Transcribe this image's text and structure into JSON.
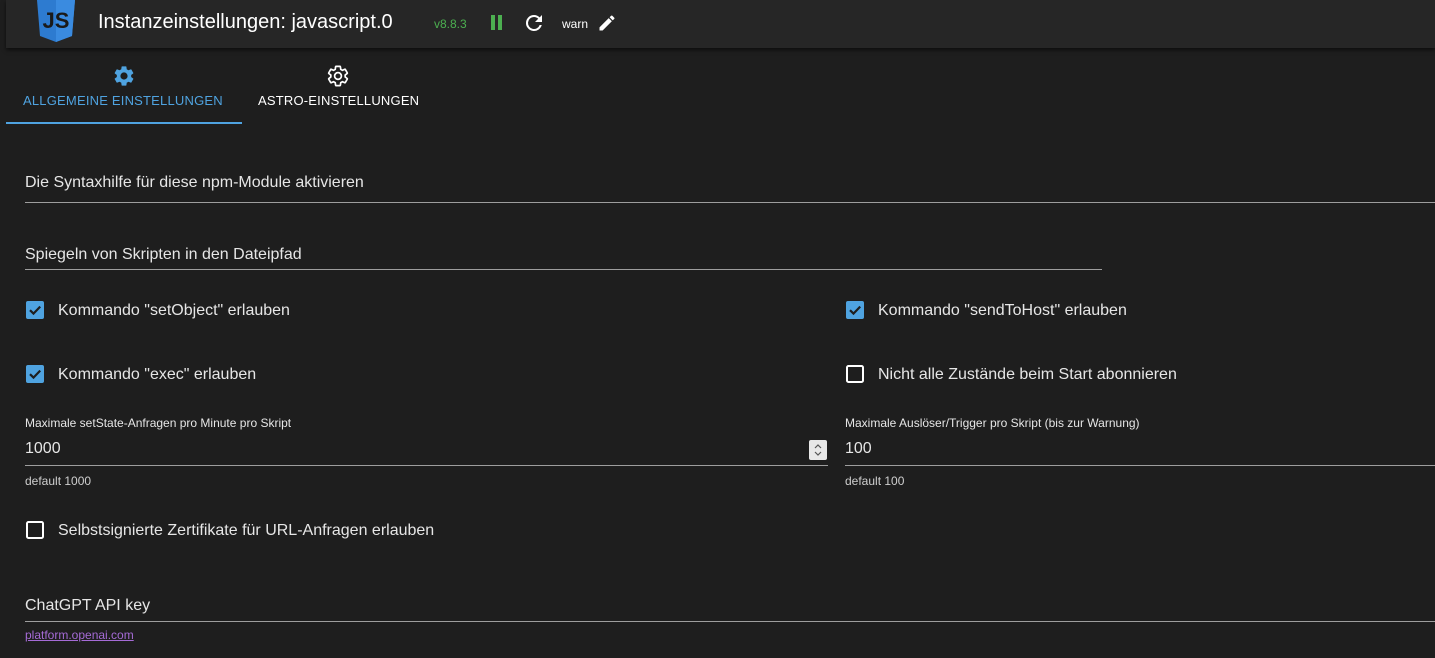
{
  "header": {
    "title": "Instanzeinstellungen: javascript.0",
    "version": "v8.8.3",
    "log_level": "warn",
    "logo_text": "JS",
    "colors": {
      "version": "#4caf50",
      "logo": "#2d7bd0",
      "pause": "#4caf50"
    }
  },
  "tabs": [
    {
      "label": "ALLGEMEINE EINSTELLUNGEN",
      "icon": "gear-filled-icon",
      "active": true
    },
    {
      "label": "ASTRO-EINSTELLUNGEN",
      "icon": "gear-outline-icon",
      "active": false
    }
  ],
  "fields": {
    "npm_modules": {
      "label": "Die Syntaxhilfe für diese npm-Module aktivieren"
    },
    "mirror_path": {
      "label": "Spiegeln von Skripten in den Dateipfad"
    }
  },
  "checkboxes": {
    "set_object": {
      "label": "Kommando \"setObject\" erlauben",
      "checked": true
    },
    "send_to_host": {
      "label": "Kommando \"sendToHost\" erlauben",
      "checked": true
    },
    "exec": {
      "label": "Kommando \"exec\" erlauben",
      "checked": true
    },
    "no_subscribe": {
      "label": "Nicht alle Zustände beim Start abonnieren",
      "checked": false
    },
    "self_signed": {
      "label": "Selbstsignierte Zertifikate für URL-Anfragen erlauben",
      "checked": false
    }
  },
  "numbers": {
    "max_set_state": {
      "label": "Maximale setState-Anfragen pro Minute pro Skript",
      "value": "1000",
      "helper": "default 1000"
    },
    "max_triggers": {
      "label": "Maximale Auslöser/Trigger pro Skript (bis zur Warnung)",
      "value": "100",
      "helper": "default 100"
    }
  },
  "chatgpt": {
    "label": "ChatGPT API key",
    "link": "platform.openai.com"
  },
  "colors": {
    "accent": "#4fa3e0",
    "checkbox": "#4fa3e0",
    "link": "#a56bd6",
    "background": "#1e1e1e",
    "header": "#262626"
  }
}
